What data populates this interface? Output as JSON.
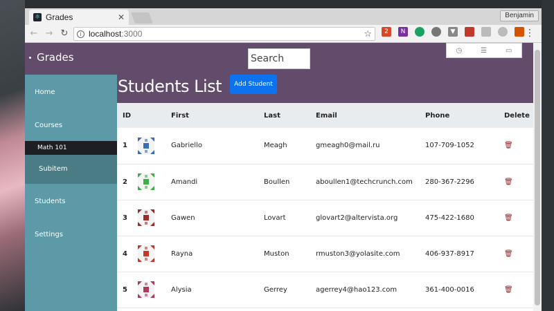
{
  "browser": {
    "tab_title": "Grades",
    "profile": "Benjamin",
    "url_host": "localhost",
    "url_port": ":3000"
  },
  "app": {
    "brand": "Grades",
    "search_placeholder": "Search",
    "page_title": "Students List",
    "add_button": "Add Student"
  },
  "sidebar": {
    "items": [
      "Home",
      "Courses",
      "Students",
      "Settings"
    ],
    "sub_course": "Math 101",
    "subitem": "Subitem"
  },
  "table": {
    "headers": [
      "ID",
      "First",
      "Last",
      "Email",
      "Phone",
      "Delete"
    ],
    "rows": [
      {
        "id": "1",
        "first": "Gabriello",
        "last": "Meagh",
        "email": "gmeagh0@mail.ru",
        "phone": "107-709-1052",
        "avatar_color": "#3b6fb5"
      },
      {
        "id": "2",
        "first": "Amandi",
        "last": "Boullen",
        "email": "aboullen1@techcrunch.com",
        "phone": "280-367-2296",
        "avatar_color": "#3fae49"
      },
      {
        "id": "3",
        "first": "Gawen",
        "last": "Lovart",
        "email": "glovart2@altervista.org",
        "phone": "475-422-1680",
        "avatar_color": "#9b2d2d"
      },
      {
        "id": "4",
        "first": "Rayna",
        "last": "Muston",
        "email": "rmuston3@yolasite.com",
        "phone": "406-937-8917",
        "avatar_color": "#c0392b"
      },
      {
        "id": "5",
        "first": "Alysia",
        "last": "Gerrey",
        "email": "agerrey4@hao123.com",
        "phone": "361-400-0016",
        "avatar_color": "#b03a5b"
      }
    ]
  },
  "colors": {
    "header_bg": "#634b6b",
    "sidebar_bg": "#5b9aa6",
    "accent_button": "#0d72f0",
    "delete_icon": "#8c1c1c"
  }
}
